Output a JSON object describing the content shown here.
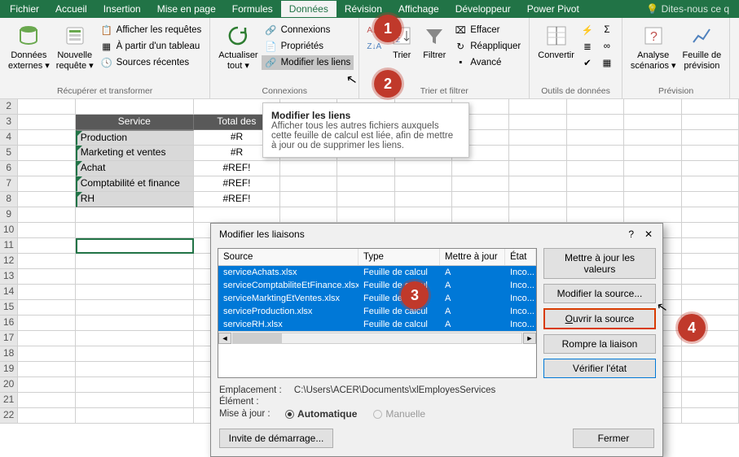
{
  "menubar": {
    "tabs": [
      "Fichier",
      "Accueil",
      "Insertion",
      "Mise en page",
      "Formules",
      "Données",
      "Révision",
      "Affichage",
      "Développeur",
      "Power Pivot"
    ],
    "active_index": 5,
    "tell_me": "Dites-nous ce q"
  },
  "ribbon": {
    "g1": {
      "bigs": [
        {
          "line1": "Données",
          "line2": "externes ▾"
        },
        {
          "line1": "Nouvelle",
          "line2": "requête ▾"
        }
      ],
      "items": [
        "Afficher les requêtes",
        "À partir d'un tableau",
        "Sources récentes"
      ],
      "label": "Récupérer et transformer"
    },
    "g2": {
      "big": {
        "line1": "Actualiser",
        "line2": "tout ▾"
      },
      "items": [
        "Connexions",
        "Propriétés",
        "Modifier les liens"
      ],
      "label": "Connexions"
    },
    "g3": {
      "bigs": [
        {
          "line1": "Trier"
        },
        {
          "line1": "Filtrer"
        }
      ],
      "items": [
        "Effacer",
        "Réappliquer",
        "Avancé"
      ],
      "label": "Trier et filtrer"
    },
    "g4": {
      "big": {
        "line1": "Convertir"
      },
      "label": "Outils de données"
    },
    "g5": {
      "bigs": [
        {
          "line1": "Analyse",
          "line2": "scénarios ▾"
        },
        {
          "line1": "Feuille de",
          "line2": "prévision"
        }
      ],
      "label": "Prévision"
    }
  },
  "tooltip": {
    "title": "Modifier les liens",
    "body": "Afficher tous les autres fichiers auxquels cette feuille de calcul est liée, afin de mettre à jour ou de supprimer les liens."
  },
  "sheet": {
    "rows_start": 2,
    "rows_end": 22,
    "headers": {
      "b": "Service",
      "c": "Total des"
    },
    "data": [
      {
        "b": "Production",
        "c": "#R"
      },
      {
        "b": "Marketing et ventes",
        "c": "#R"
      },
      {
        "b": "Achat",
        "c": "#REF!"
      },
      {
        "b": "Comptabilité et finance",
        "c": "#REF!"
      },
      {
        "b": "RH",
        "c": "#REF!"
      }
    ],
    "selected_row": 11
  },
  "dialog": {
    "title": "Modifier les liaisons",
    "cols": {
      "src": "Source",
      "type": "Type",
      "upd": "Mettre à jour",
      "stat": "État"
    },
    "rows": [
      {
        "src": "serviceAchats.xlsx",
        "type": "Feuille de calcul",
        "upd": "A",
        "stat": "Inco..."
      },
      {
        "src": "serviceComptabiliteEtFinance.xlsx",
        "type": "Feuille de calcul",
        "upd": "A",
        "stat": "Inco..."
      },
      {
        "src": "serviceMarktingEtVentes.xlsx",
        "type": "Feuille de calcul",
        "upd": "A",
        "stat": "Inco..."
      },
      {
        "src": "serviceProduction.xlsx",
        "type": "Feuille de calcul",
        "upd": "A",
        "stat": "Inco..."
      },
      {
        "src": "serviceRH.xlsx",
        "type": "Feuille de calcul",
        "upd": "A",
        "stat": "Inco..."
      }
    ],
    "buttons": {
      "update": "Mettre à jour les valeurs",
      "change": "Modifier la source...",
      "open": "Ouvrir la source",
      "break": "Rompre la liaison",
      "check": "Vérifier l'état"
    },
    "loc_label": "Emplacement :",
    "loc_value": "C:\\Users\\ACER\\Documents\\xlEmployesServices",
    "elem_label": "Élément :",
    "upd_label": "Mise à jour :",
    "upd_auto": "Automatique",
    "upd_manual": "Manuelle",
    "prompt": "Invite de démarrage...",
    "close": "Fermer"
  },
  "callouts": {
    "1": "1",
    "2": "2",
    "3": "3",
    "4": "4"
  }
}
